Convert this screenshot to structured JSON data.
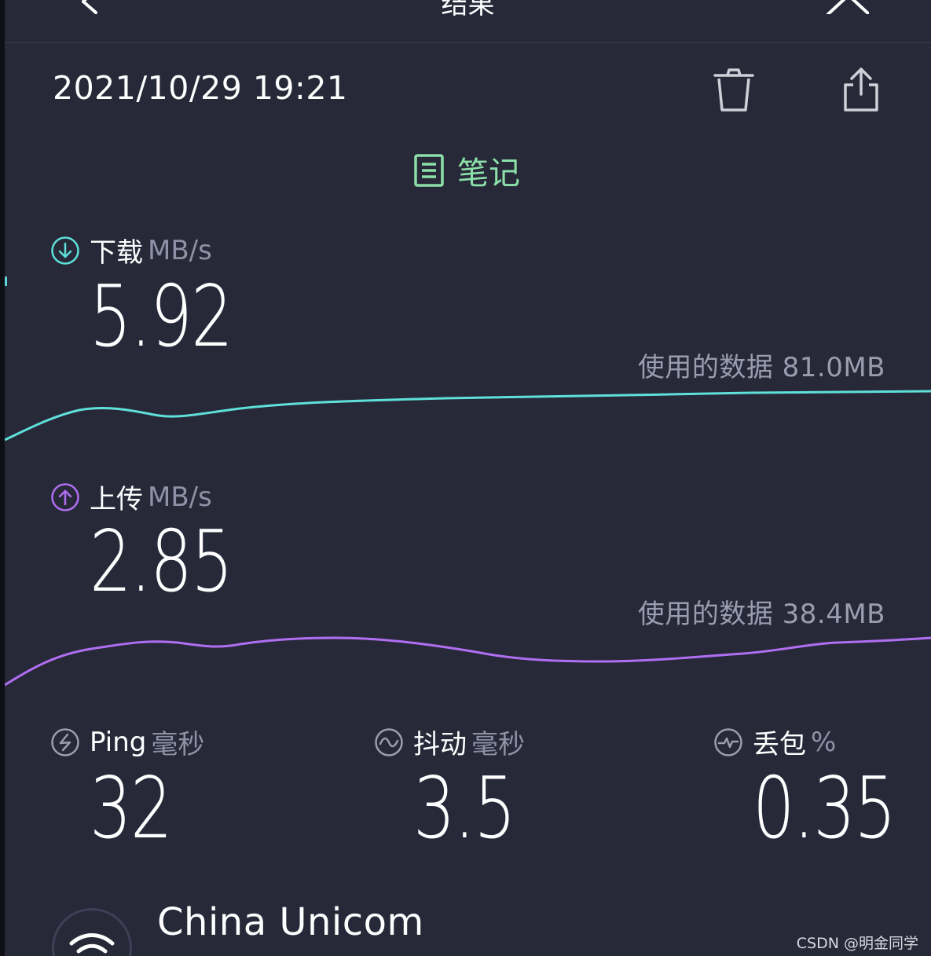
{
  "header": {
    "title": "结果",
    "back_icon": "chevron-left-icon",
    "close_icon": "close-icon"
  },
  "result": {
    "datetime": "2021/10/29 19:21",
    "delete_icon": "trash-icon",
    "share_icon": "share-icon",
    "notes_label": "笔记"
  },
  "download": {
    "label": "下载",
    "unit": "MB/s",
    "value": "5.92",
    "data_used": "使用的数据 81.0MB",
    "color": "#5fe0d9"
  },
  "upload": {
    "label": "上传",
    "unit": "MB/s",
    "value": "2.85",
    "data_used": "使用的数据 38.4MB",
    "color": "#b06ef2"
  },
  "stats": {
    "ping": {
      "label": "Ping",
      "unit": "毫秒",
      "value": "32"
    },
    "jitter": {
      "label": "抖动",
      "unit": "毫秒",
      "value": "3.5"
    },
    "loss": {
      "label": "丢包",
      "unit": "%",
      "value": "0.35"
    }
  },
  "provider": {
    "name": "China Unicom",
    "icon": "wifi-icon"
  },
  "watermark": "CSDN @明金同学",
  "colors": {
    "background": "#272939",
    "notes": "#8be0a8",
    "muted_text": "#9a9db0"
  }
}
